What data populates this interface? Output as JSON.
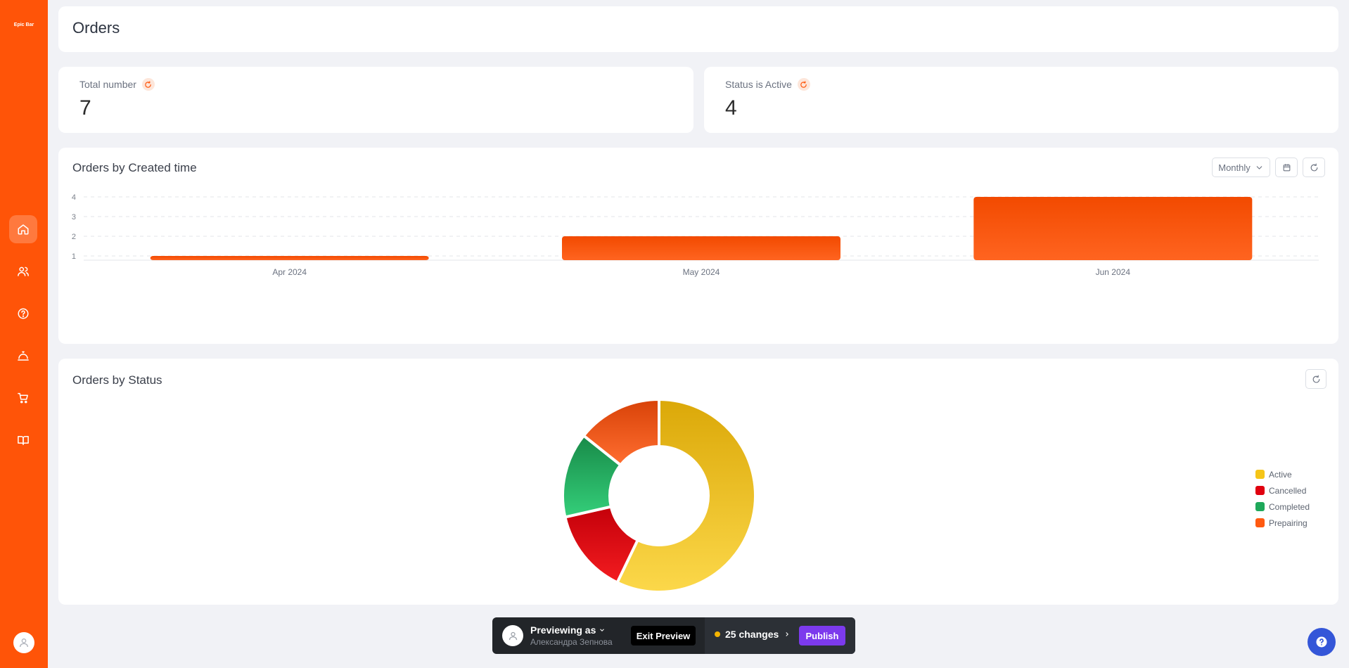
{
  "sidebar": {
    "brand": "Epic Bar",
    "items": [
      {
        "name": "home-icon",
        "active": true
      },
      {
        "name": "users-icon",
        "active": false
      },
      {
        "name": "help-circle-icon",
        "active": false
      },
      {
        "name": "cloche-icon",
        "active": false
      },
      {
        "name": "cart-icon",
        "active": false
      },
      {
        "name": "book-icon",
        "active": false
      }
    ]
  },
  "page": {
    "title": "Orders"
  },
  "stats": [
    {
      "label": "Total number",
      "value": "7"
    },
    {
      "label": "Status is Active",
      "value": "4"
    }
  ],
  "orders_by_time": {
    "title": "Orders by Created time",
    "period_label": "Monthly"
  },
  "orders_by_status": {
    "title": "Orders by Status"
  },
  "chart_data": [
    {
      "type": "bar",
      "title": "Orders by Created time",
      "categories": [
        "Apr 2024",
        "May 2024",
        "Jun 2024"
      ],
      "values": [
        1,
        2,
        4
      ],
      "ylim": [
        1,
        4
      ],
      "yticks": [
        "1",
        "2",
        "3",
        "4"
      ],
      "grid": true,
      "color": "#ff5408"
    },
    {
      "type": "pie",
      "title": "Orders by Status",
      "donut": true,
      "labels": [
        "Active",
        "Cancelled",
        "Completed",
        "Prepairing"
      ],
      "values": [
        4,
        1,
        1,
        1
      ],
      "colors": [
        "#f5c518",
        "#e0000f",
        "#1fa85a",
        "#ff5a10"
      ],
      "legend_position": "right"
    }
  ],
  "preview_bar": {
    "title": "Previewing as",
    "user_name": "Александра Зепнова",
    "exit_label": "Exit Preview",
    "changes_label": "25 changes",
    "publish_label": "Publish"
  }
}
